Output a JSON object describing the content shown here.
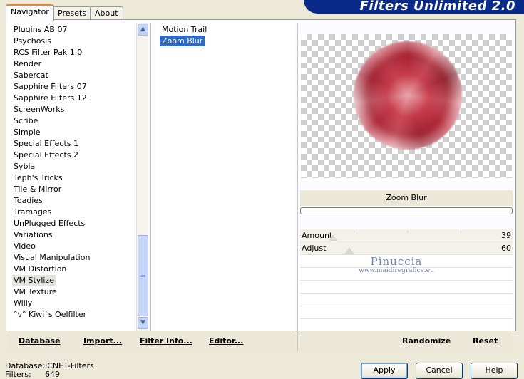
{
  "banner": {
    "title": "Filters Unlimited 2.0"
  },
  "tabs": [
    {
      "label": "Navigator",
      "active": true
    },
    {
      "label": "Presets",
      "active": false
    },
    {
      "label": "About",
      "active": false
    }
  ],
  "categories": [
    {
      "label": "Plugins AB 07"
    },
    {
      "label": "Psychosis"
    },
    {
      "label": "RCS Filter Pak 1.0"
    },
    {
      "label": "Render"
    },
    {
      "label": "Sabercat"
    },
    {
      "label": "Sapphire Filters 07"
    },
    {
      "label": "Sapphire Filters 12"
    },
    {
      "label": "ScreenWorks"
    },
    {
      "label": "Scribe"
    },
    {
      "label": "Simple"
    },
    {
      "label": "Special Effects 1"
    },
    {
      "label": "Special Effects 2"
    },
    {
      "label": "Sybia"
    },
    {
      "label": "Teph's Tricks"
    },
    {
      "label": "Tile & Mirror"
    },
    {
      "label": "Toadies"
    },
    {
      "label": "Tramages"
    },
    {
      "label": "UnPlugged Effects"
    },
    {
      "label": "Variations"
    },
    {
      "label": "Video"
    },
    {
      "label": "Visual Manipulation"
    },
    {
      "label": "VM Distortion"
    },
    {
      "label": "VM Stylize",
      "selected": true
    },
    {
      "label": "VM Texture"
    },
    {
      "label": "Willy"
    },
    {
      "label": "°v° Kiwi`s Oelfilter"
    }
  ],
  "filters": [
    {
      "label": "Motion Trail"
    },
    {
      "label": "Zoom Blur",
      "selected": true
    }
  ],
  "preview": {
    "filter_name": "Zoom Blur"
  },
  "params": [
    {
      "name": "Amount",
      "value": "39"
    },
    {
      "name": "Adjust",
      "value": "60"
    }
  ],
  "watermark": {
    "title": "Pinuccia",
    "url": "www.maidiregrafica.eu"
  },
  "toolbar": {
    "database": "Database",
    "import": "Import...",
    "filter_info": "Filter Info...",
    "editor": "Editor...",
    "randomize": "Randomize",
    "reset": "Reset"
  },
  "info": {
    "database_label": "Database:",
    "database_value": "ICNET-Filters",
    "filters_label": "Filters:",
    "filters_value": "649"
  },
  "buttons": {
    "apply": "Apply",
    "cancel": "Cancel",
    "help": "Help"
  },
  "colors": {
    "banner": "#0a2a8a",
    "selection": "#316ac5",
    "tab_highlight": "#e68b2c"
  }
}
